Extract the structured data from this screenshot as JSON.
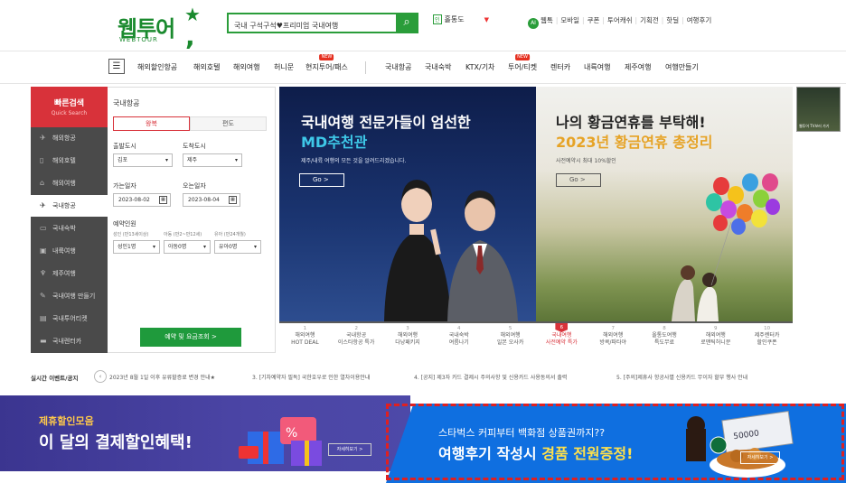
{
  "header": {
    "logo_text": "웹투어",
    "logo_sub": "WEBTOUR",
    "search_value": "국내 구석구석♥프리미엄 국내여행",
    "dropdown_badge": "인",
    "dropdown_label": "홀통도",
    "ai_badge": "AI",
    "top_links": [
      "웹톡",
      "모바일",
      "쿠폰",
      "투어캐쉬",
      "기획전",
      "핫딜",
      "여행후기"
    ]
  },
  "nav": {
    "items": [
      {
        "label": "해외할인항공"
      },
      {
        "label": "해외호텔"
      },
      {
        "label": "해외여행"
      },
      {
        "label": "허니문"
      },
      {
        "label": "현지투어/패스",
        "badge": "NEW"
      },
      {
        "label": "국내항공"
      },
      {
        "label": "국내숙박"
      },
      {
        "label": "KTX/기차"
      },
      {
        "label": "투어/티켓",
        "badge": "NEW"
      },
      {
        "label": "렌터카"
      },
      {
        "label": "내륙여행"
      },
      {
        "label": "제주여행"
      },
      {
        "label": "여행만들기"
      }
    ]
  },
  "quick_search": {
    "title": "빠른검색",
    "subtitle": "Quick Search",
    "side_items": [
      {
        "label": "해외항공",
        "icon": "plane-icon",
        "glyph": "✈"
      },
      {
        "label": "해외호텔",
        "icon": "hotel-icon",
        "glyph": "▯"
      },
      {
        "label": "해외여행",
        "icon": "building-icon",
        "glyph": "⌂"
      },
      {
        "label": "국내항공",
        "icon": "plane-icon",
        "glyph": "✈",
        "active": true
      },
      {
        "label": "국내숙박",
        "icon": "bed-icon",
        "glyph": "▭"
      },
      {
        "label": "내륙여행",
        "icon": "bus-icon",
        "glyph": "▣"
      },
      {
        "label": "제주여행",
        "icon": "island-icon",
        "glyph": "♆"
      },
      {
        "label": "국내여행 만들기",
        "icon": "pencil-icon",
        "glyph": "✎"
      },
      {
        "label": "국내투어티켓",
        "icon": "ticket-icon",
        "glyph": "▤"
      },
      {
        "label": "국내렌터카",
        "icon": "car-icon",
        "glyph": "▬"
      }
    ],
    "form": {
      "section_title": "국내항공",
      "tab_round": "왕복",
      "tab_oneway": "편도",
      "depart_label": "출발도시",
      "depart_value": "김포",
      "arrive_label": "도착도시",
      "arrive_value": "제주",
      "go_date_label": "가는일자",
      "go_date_value": "2023-08-02",
      "return_date_label": "오는일자",
      "return_date_value": "2023-08-04",
      "pax_label": "예약인원",
      "adult_sub": "성인 (만13세이상)",
      "child_sub": "아동 (만2~만12세)",
      "infant_sub": "유아 (만24개월)",
      "adult_value": "성인1명",
      "child_value": "아동0명",
      "infant_value": "유아0명",
      "submit": "예약 및 요금조회 >"
    }
  },
  "banners": {
    "left": {
      "title_line1": "국내여행 전문가들이 엄선한",
      "title_line2": "MD추천관",
      "desc": "제주/내륙 여행의 모든 것을 알려드리겠습니다.",
      "go": "Go  >"
    },
    "right": {
      "title_line1": "나의 황금연휴를 부탁해!",
      "title_line2": "2023년 황금연휴 총정리",
      "desc": "사전예약시 최대 10%할인",
      "go": "Go  >"
    },
    "tabs": [
      {
        "num": "1",
        "l1": "해외여행",
        "l2": "HOT DEAL"
      },
      {
        "num": "2",
        "l1": "국내항공",
        "l2": "이스타항공 특가"
      },
      {
        "num": "3",
        "l1": "해외여행",
        "l2": "다낭패키지"
      },
      {
        "num": "4",
        "l1": "국내숙박",
        "l2": "여름나기"
      },
      {
        "num": "5",
        "l1": "해외여행",
        "l2": "일본 오사카"
      },
      {
        "num": "6",
        "l1": "국내여행",
        "l2": "사전예약 특가",
        "active": true
      },
      {
        "num": "7",
        "l1": "해외여행",
        "l2": "방콕/파타야"
      },
      {
        "num": "8",
        "l1": "올통도여행",
        "l2": "특도무료"
      },
      {
        "num": "9",
        "l1": "해외여행",
        "l2": "로맨틱허니문"
      },
      {
        "num": "10",
        "l1": "제주렌터카",
        "l2": "할인쿠폰"
      }
    ],
    "side_thumb": "웹투어 TV보러 가기"
  },
  "events": {
    "title": "실시간 이벤트/공지",
    "items": [
      "2023년 8월 1일 이후 유류할증료 변경 안내★",
      "3. [기차예약자 필독] 국한호우로 인한 열차이용안내",
      "4. [공지] 제3자 카드 결제시 주의사항 및 신용카드 사용동의서 출력",
      "5. [주의]제휴사 항공사별 신용카드 무이자 할부 행사 안내"
    ]
  },
  "promos": {
    "left_line1": "제휴할인모음",
    "left_line2": "이 달의 결제할인혜택!",
    "left_more": "자세히보기 >",
    "right_line1": "스타벅스 커피부터 백화점 상품권까지??",
    "right_line2a": "여행후기 작성시 ",
    "right_line2b": "경품 전원증정!",
    "right_more": "자세히보기 >",
    "voucher": "50000"
  }
}
